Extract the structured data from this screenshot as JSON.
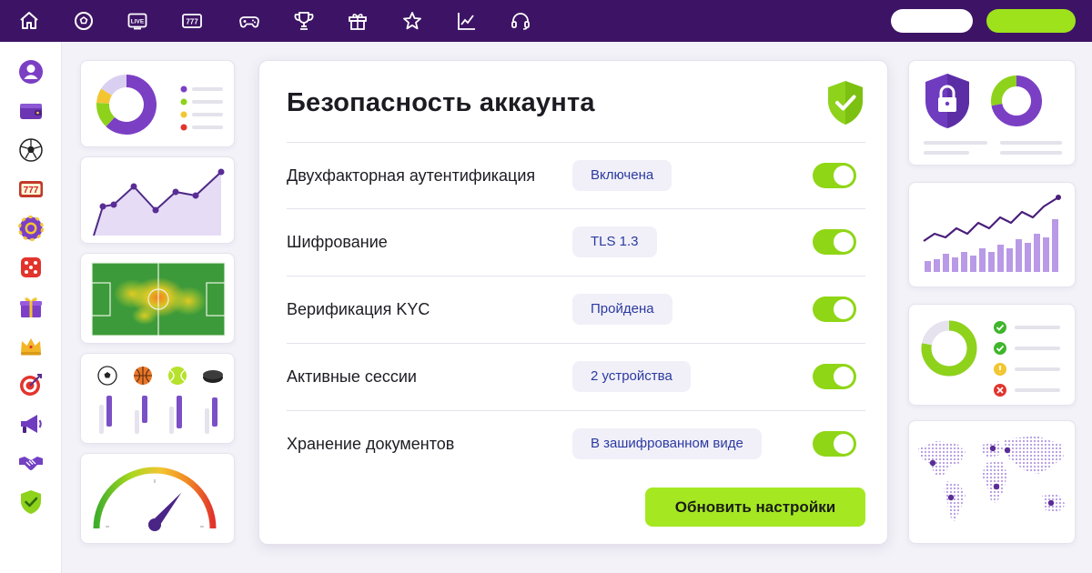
{
  "security": {
    "title": "Безопасность аккаунта",
    "rows": [
      {
        "label": "Двухфакторная аутентификация",
        "value": "Включена",
        "enabled": true
      },
      {
        "label": "Шифрование",
        "value": "TLS 1.3",
        "enabled": true
      },
      {
        "label": "Верификация KYC",
        "value": "Пройдена",
        "enabled": true
      },
      {
        "label": "Активные сессии",
        "value": "2 устройства",
        "enabled": true
      },
      {
        "label": "Хранение документов",
        "value": "В зашифрованном виде",
        "enabled": true
      }
    ],
    "update_button": "Обновить настройки"
  },
  "nav_icons": [
    "home-icon",
    "soccer-ball-icon",
    "live-icon",
    "slot-777-icon",
    "gamepad-icon",
    "trophy-icon",
    "gift-icon",
    "star-icon",
    "chart-line-icon",
    "headset-icon"
  ],
  "sidebar_icons": [
    "user-icon",
    "wallet-icon",
    "soccer-ball-icon",
    "slot-777-icon",
    "casino-chip-icon",
    "dice-icon",
    "gift-icon",
    "crown-icon",
    "target-icon",
    "megaphone-icon",
    "handshake-icon",
    "shield-check-icon"
  ],
  "colors": {
    "topbar": "#3d1465",
    "accent_green": "#9ee21c",
    "accent_purple": "#7e4fc2",
    "chip_text": "#2b3aa0"
  },
  "donut_left": {
    "segments": [
      0.62,
      0.14,
      0.08,
      0.16
    ]
  },
  "donut_right": {
    "fill": 0.72
  },
  "gauge": {
    "level": 0.72
  }
}
